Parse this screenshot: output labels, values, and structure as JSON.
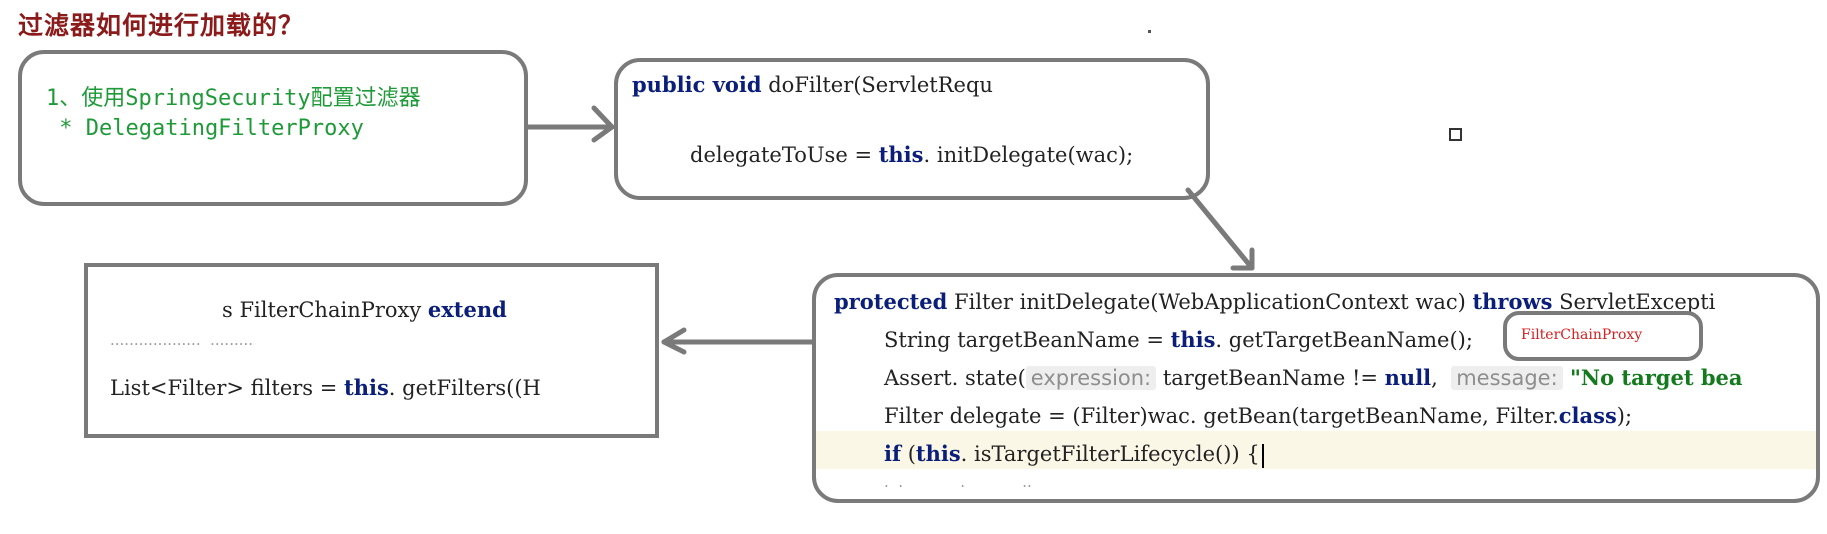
{
  "title": "过滤器如何进行加载的？",
  "step_box": {
    "line1": "1、使用SpringSecurity配置过滤器",
    "line2": " * DelegatingFilterProxy"
  },
  "dofilter_box": {
    "line1_kw": "public void",
    "line1_rest": " doFilter(ServletRequ",
    "line2_pre": "delegateToUse = ",
    "line2_kw": "this",
    "line2_rest": ". initDelegate(wac);"
  },
  "filterchain_box": {
    "line1_pre": "s FilterChainProxy ",
    "line1_kw": "extend",
    "line3_pre": "List<Filter> filters = ",
    "line3_kw": "this",
    "line3_rest": ". getFilters((H"
  },
  "initdelegate_box": {
    "line1_kw1": "protected",
    "line1_mid": " Filter initDelegate(WebApplicationContext wac) ",
    "line1_kw2": "throws",
    "line1_rest": " ServletExcepti",
    "line2_pre": "String targetBeanName = ",
    "line2_kw": "this",
    "line2_rest": ". getTargetBeanName();",
    "line3_pre": "Assert. state(",
    "line3_hint1": "expression:",
    "line3_mid": " targetBeanName != ",
    "line3_kw": "null",
    "line3_comma": ",",
    "line3_hint2": "message:",
    "line3_str": " \"No target bea",
    "line4_pre": "Filter delegate = (Filter)wac. getBean(targetBeanName, Filter.",
    "line4_kw": "class",
    "line4_rest": ");",
    "line5_kw1": "if",
    "line5_mid": " (",
    "line5_kw2": "this",
    "line5_rest": ". isTargetFilterLifecycle()) {"
  },
  "annotation": {
    "text": "FilterChainProxy"
  },
  "colors": {
    "title": "#8b1a1a",
    "green_text": "#1f9a38",
    "keyword": "#0a1e7a",
    "annotation": "#d42020",
    "box_border": "#7a7a7a"
  }
}
